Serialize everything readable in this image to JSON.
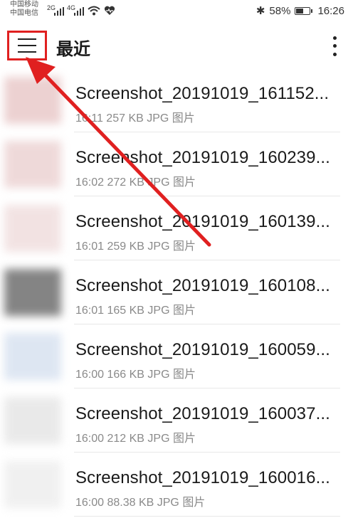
{
  "status_bar": {
    "carrier1": "中国移动",
    "carrier2": "中国电信",
    "sig1": "2G",
    "sig2": "4G",
    "battery_text": "58%",
    "battery_level": 0.58,
    "time": "16:26"
  },
  "header": {
    "title": "最近"
  },
  "files": [
    {
      "name": "Screenshot_20191019_161152...",
      "meta": "16:11 257 KB JPG 图片",
      "thumb": "#e9c9c9"
    },
    {
      "name": "Screenshot_20191019_160239...",
      "meta": "16:02 272 KB JPG 图片",
      "thumb": "#ecd3d3"
    },
    {
      "name": "Screenshot_20191019_160139...",
      "meta": "16:01 259 KB JPG 图片",
      "thumb": "#f0dede"
    },
    {
      "name": "Screenshot_20191019_160108...",
      "meta": "16:01 165 KB JPG 图片",
      "thumb": "#6f6f6f"
    },
    {
      "name": "Screenshot_20191019_160059...",
      "meta": "16:00 166 KB JPG 图片",
      "thumb": "#d8e2f0"
    },
    {
      "name": "Screenshot_20191019_160037...",
      "meta": "16:00 212 KB JPG 图片",
      "thumb": "#e6e6e6"
    },
    {
      "name": "Screenshot_20191019_160016...",
      "meta": "16:00 88.38 KB JPG 图片",
      "thumb": "#eeeeee"
    }
  ],
  "colors": {
    "highlight": "#e02020"
  }
}
